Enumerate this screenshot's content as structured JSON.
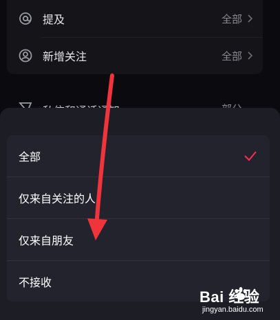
{
  "background_list": {
    "rows": [
      {
        "label": "提及",
        "value": "全部",
        "icon": "at-icon"
      },
      {
        "label": "新增关注",
        "value": "全部",
        "icon": "user-circle-icon"
      }
    ],
    "partial_row": {
      "label": "私信和通话通知",
      "value": "部分",
      "icon": "message-icon"
    }
  },
  "sheet": {
    "options": [
      {
        "label": "全部",
        "selected": true
      },
      {
        "label": "仅来自关注的人",
        "selected": false
      },
      {
        "label": "仅来自朋友",
        "selected": false
      },
      {
        "label": "不接收",
        "selected": false
      }
    ],
    "check_color": "#fe2c55"
  },
  "annotation": {
    "arrow_color": "#f0343c"
  },
  "watermark": {
    "brand": "Bai  经验",
    "url": "jingyan.baidu.com"
  }
}
